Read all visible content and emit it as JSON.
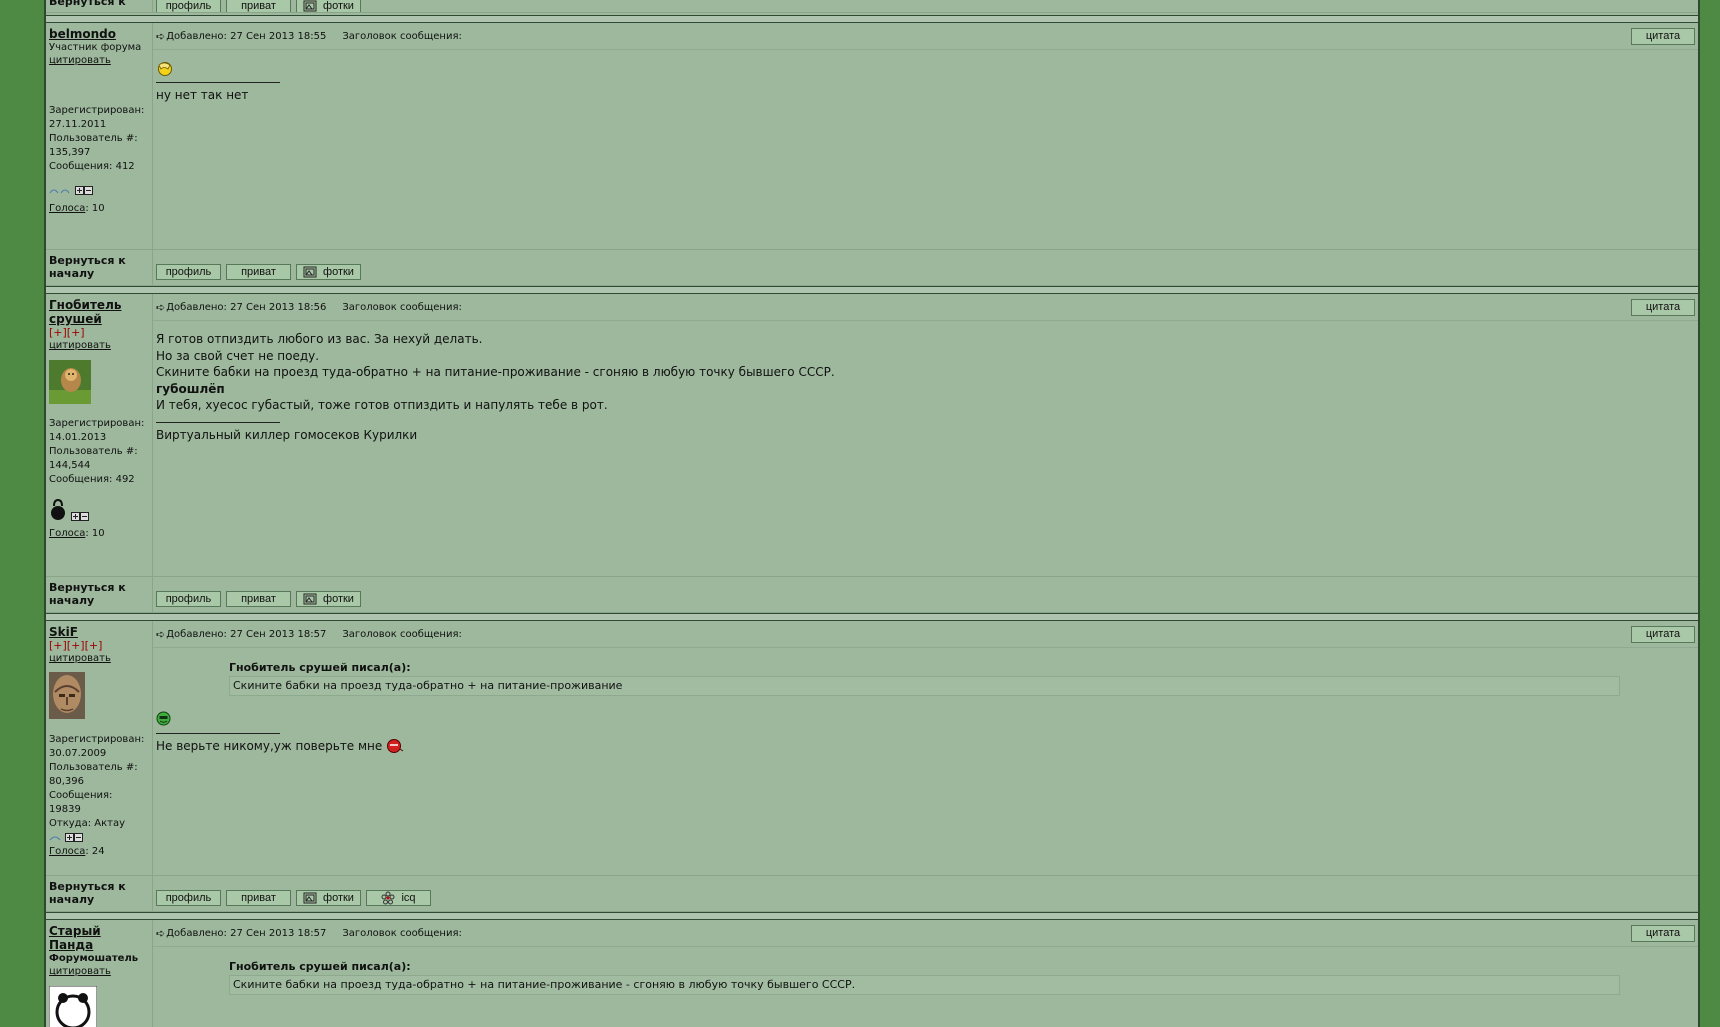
{
  "nav": {
    "back_to_top": "Вернуться к началу",
    "profile": "профиль",
    "private": "приват",
    "photos": "фотки",
    "icq": "icq",
    "quote_button": "цитата",
    "quote_link": "цитировать",
    "posted_prefix": "Добавлено:",
    "subject_label": "Заголовок сообщения:",
    "registered_label": "Зарегистрирован:",
    "user_num_label": "Пользователь #:",
    "messages_label": "Сообщения:",
    "from_label": "Откуда:",
    "votes_label": "Голоса"
  },
  "posts": [
    {
      "author": "belmondo",
      "rank": "Участник форума",
      "date": "27 Сен 2013 18:55",
      "registered": "27.11.2011",
      "user_num": "135,397",
      "messages": "412",
      "votes": "10",
      "body": [],
      "signature": "ну нет так нет"
    },
    {
      "author": "Гнобитель срушей",
      "rank": "[+][+]",
      "date": "27 Сен 2013 18:56",
      "registered": "14.01.2013",
      "user_num": "144,544",
      "messages": "492",
      "votes": "10",
      "body": [
        "Я готов отпиздить любого из вас. За нехуй делать.",
        "Но за свой счет не поеду.",
        "Скините бабки на проезд туда-обратно + на питание-проживание - сгоняю в любую точку бывшего СССР.",
        "губошлёп",
        "И тебя, хуесос губастый, тоже готов отпиздить и напулять тебе в рот."
      ],
      "signature": "Виртуальный киллер гомосеков Курилки"
    },
    {
      "author": "SkiF",
      "rank": "[+][+][+]",
      "date": "27 Сен 2013 18:57",
      "registered": "30.07.2009",
      "user_num": "80,396",
      "messages": "19839",
      "from": "Актау",
      "votes": "24",
      "quote_author": "Гнобитель срушей писал(а):",
      "quote_text": "Скините бабки на проезд туда-обратно + на питание-проживание",
      "signature": "Не верьте никому,уж поверьте мне"
    },
    {
      "author": "Старый Панда",
      "rank": "Форумошатель",
      "date": "27 Сен 2013 18:57",
      "quote_author": "Гнобитель срушей писал(а):",
      "quote_text": "Скините бабки на проезд туда-обратно + на питание-проживание - сгоняю в любую точку бывшего СССР."
    }
  ],
  "colors": {
    "page_bg": "#4f8a45",
    "panel_bg": "#9db89d",
    "button_bg": "#a9c8a7",
    "plus_red": "#a00000"
  }
}
